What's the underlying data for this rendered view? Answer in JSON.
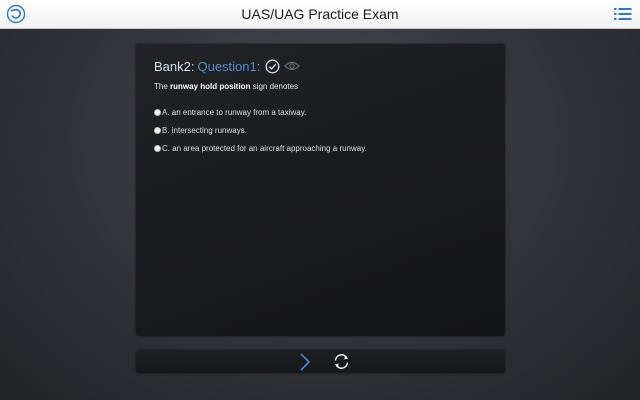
{
  "header": {
    "title": "UAS/UAG Practice Exam",
    "left_icon": "refresh-icon",
    "right_icon": "menu-list-icon"
  },
  "question": {
    "bank": "Bank2:",
    "number": "Question1:",
    "status_icon": "check-circle-icon",
    "view_icon": "eye-icon",
    "text_before": "The ",
    "text_bold": "runway hold position",
    "text_after": " sign denotes",
    "options": [
      {
        "label": "A. an entrance to runway from a taxiway."
      },
      {
        "label": "B. intersecting runways."
      },
      {
        "label": "C. an area protected for an aircraft approaching a runway."
      }
    ]
  },
  "footer": {
    "next_icon": "chevron-right-icon",
    "reset_icon": "refresh-arrows-icon"
  },
  "colors": {
    "accent": "#4f8fd0",
    "bank_text": "#cfe0f3",
    "card_bg": "#1c1d20",
    "page_bg": "#3a3d42"
  }
}
